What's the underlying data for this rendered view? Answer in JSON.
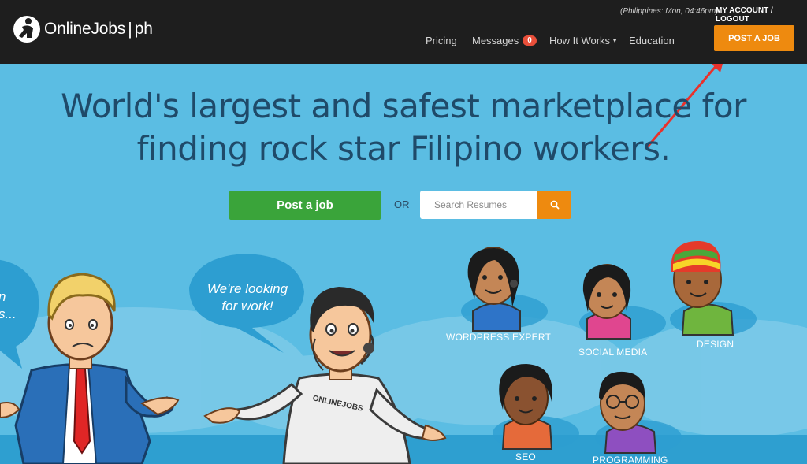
{
  "header": {
    "logo_brand": "OnlineJobs",
    "logo_tld": "ph",
    "timezone": "(Philippines: Mon, 04:46pm)",
    "account_link": "MY ACCOUNT / LOGOUT",
    "nav": {
      "pricing": "Pricing",
      "messages": "Messages",
      "messages_count": "0",
      "how_it_works": "How It Works",
      "education": "Education"
    },
    "post_job": "POST A JOB"
  },
  "hero": {
    "title_line1": "World's largest and safest marketplace for",
    "title_line2": "finding rock star Filipino workers.",
    "post_job": "Post a job",
    "or": "OR",
    "search_placeholder": "Search Resumes"
  },
  "scene": {
    "left_bubble_line1": "n",
    "left_bubble_line2": "s...",
    "worker_bubble_line1": "We're looking",
    "worker_bubble_line2": "for work!",
    "shirt_text": "ONLINEJOBS",
    "categories": {
      "wordpress": "WORDPRESS EXPERT",
      "social": "SOCIAL MEDIA",
      "design": "DESIGN",
      "seo": "SEO",
      "programming": "PROGRAMMING"
    }
  },
  "colors": {
    "header_bg": "#1e1e1e",
    "hero_bg": "#5bbde3",
    "accent_orange": "#ee8a0f",
    "post_green": "#3aa43a",
    "title_navy": "#1f4a69",
    "badge_red": "#e94f3a",
    "arrow_red": "#e8312c"
  },
  "icons": {
    "logo": "person-carrying-logo-icon",
    "search": "search-icon",
    "dropdown": "chevron-down-icon"
  }
}
